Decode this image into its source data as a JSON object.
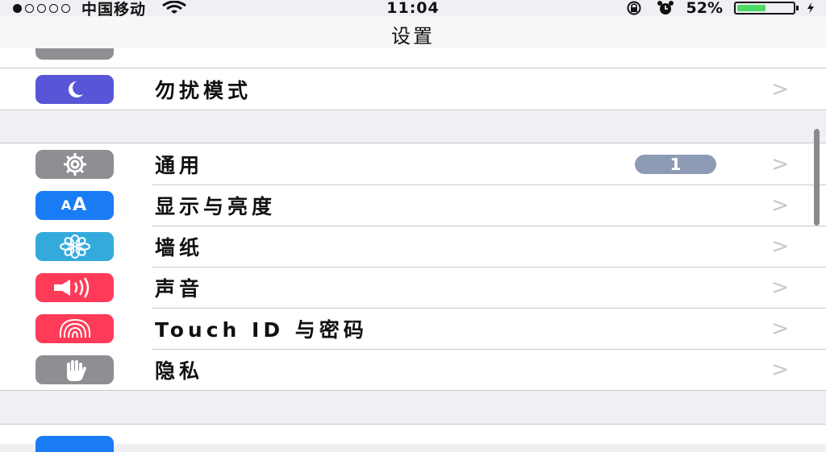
{
  "status_bar": {
    "carrier": "中国移动",
    "time": "11:04",
    "battery_percent": "52%",
    "signal_bars_filled": 1,
    "battery_level": 0.52
  },
  "nav": {
    "title": "设置"
  },
  "group_top": {
    "rows": [
      {
        "label": "勿扰模式",
        "icon": "moon-icon",
        "color": "#5856d6"
      }
    ]
  },
  "group_main": {
    "rows": [
      {
        "label": "通用",
        "icon": "gear-icon",
        "color": "#8e8e93",
        "badge": "1"
      },
      {
        "label": "显示与亮度",
        "icon": "text-size-icon",
        "color": "#1a7cf5"
      },
      {
        "label": "墙纸",
        "icon": "flower-icon",
        "color": "#34aadc"
      },
      {
        "label": "声音",
        "icon": "speaker-icon",
        "color": "#ff3b58"
      },
      {
        "label": "Touch ID 与密码",
        "icon": "fingerprint-icon",
        "color": "#ff3b58"
      },
      {
        "label": "隐私",
        "icon": "hand-icon",
        "color": "#8e8e93"
      }
    ]
  },
  "chevron": ">"
}
